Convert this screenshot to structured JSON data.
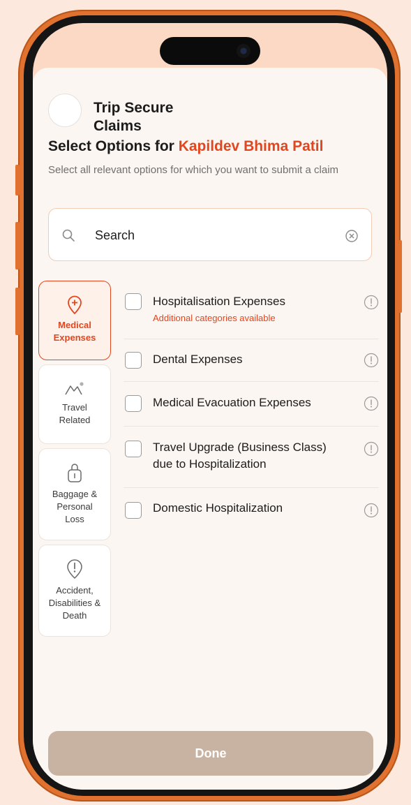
{
  "header": {
    "brand_line1": "Trip Secure",
    "brand_line2": "Claims",
    "title_prefix": "Select Options for ",
    "insured_name": "Kapildev Bhima Patil",
    "subtitle": "Select all relevant options for which you want to submit a claim"
  },
  "search": {
    "placeholder": "Search",
    "value": ""
  },
  "categories": [
    {
      "label_line1": "Medical",
      "label_line2": "Expenses",
      "label_line3": "",
      "icon": "map-pin-plus-icon",
      "selected": true
    },
    {
      "label_line1": "Travel",
      "label_line2": "Related",
      "label_line3": "",
      "icon": "mountain-icon",
      "selected": false
    },
    {
      "label_line1": "Baggage &",
      "label_line2": "Personal",
      "label_line3": "Loss",
      "icon": "luggage-icon",
      "selected": false
    },
    {
      "label_line1": "Accident,",
      "label_line2": "Disabilities &",
      "label_line3": "Death",
      "icon": "alert-pin-icon",
      "selected": false
    }
  ],
  "options": [
    {
      "label": "Hospitalisation Expenses",
      "sublabel": "Additional categories available"
    },
    {
      "label": "Dental Expenses",
      "sublabel": ""
    },
    {
      "label": "Medical Evacuation Expenses",
      "sublabel": ""
    },
    {
      "label": "Travel Upgrade (Business Class) due to Hospitalization",
      "sublabel": ""
    },
    {
      "label": "Domestic Hospitalization",
      "sublabel": ""
    }
  ],
  "footer": {
    "done_label": "Done"
  },
  "colors": {
    "accent": "#e2461f",
    "done_disabled": "#c8b3a3",
    "phone_frame": "#e0712e",
    "background": "#fce8dc"
  }
}
